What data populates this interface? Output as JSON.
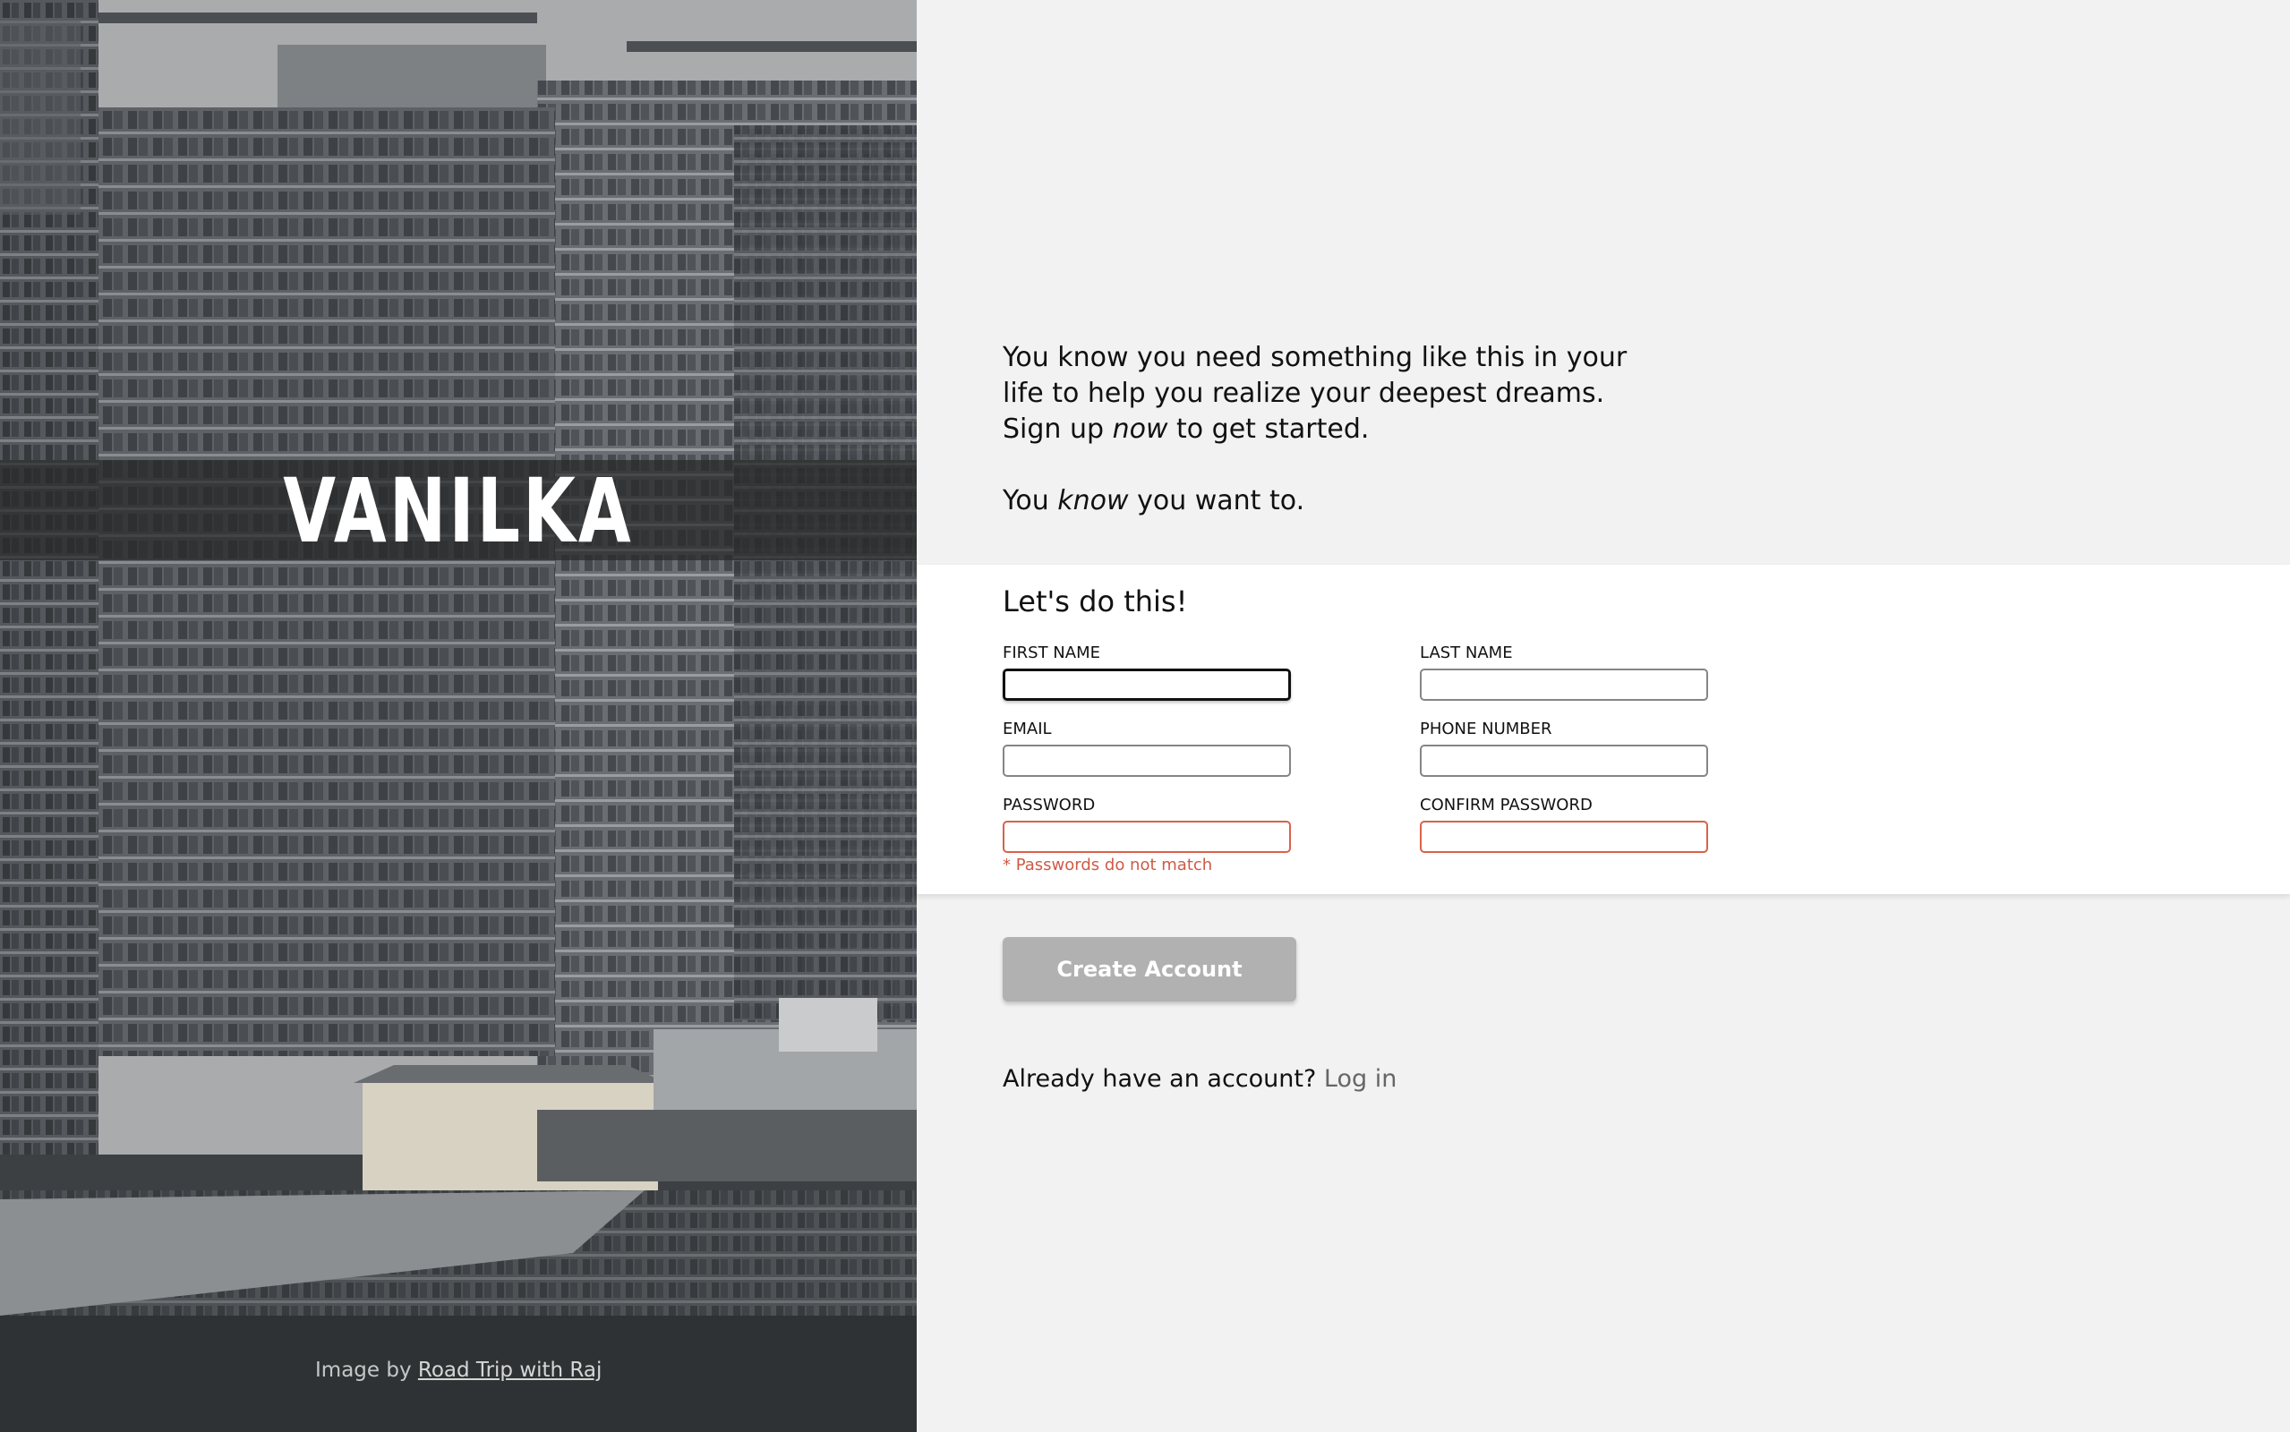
{
  "hero": {
    "brand": "VANILKA",
    "credit_prefix": "Image by",
    "credit_link": "Road Trip with Raj"
  },
  "intro": {
    "line1": "You know you need something like this in your life to help you realize your deepest dreams.",
    "line2_before": "Sign up",
    "line2_em": "now",
    "line2_after": "to get started.",
    "line3_before": "You",
    "line3_em": "know",
    "line3_after": "you want to."
  },
  "form": {
    "heading": "Let's do this!",
    "fields": {
      "first_name": {
        "label": "FIRST NAME",
        "value": ""
      },
      "last_name": {
        "label": "LAST NAME",
        "value": ""
      },
      "email": {
        "label": "EMAIL",
        "value": ""
      },
      "phone": {
        "label": "PHONE NUMBER",
        "value": ""
      },
      "password": {
        "label": "PASSWORD",
        "value": ""
      },
      "confirm_password": {
        "label": "CONFIRM PASSWORD",
        "value": ""
      }
    },
    "error": "* Passwords do not match"
  },
  "actions": {
    "create_label": "Create Account",
    "login_prompt": "Already have an account?",
    "login_link": "Log in"
  },
  "colors": {
    "error": "#d9624a",
    "button_disabled": "#b1b1b1",
    "page_bg": "#f2f2f2"
  }
}
